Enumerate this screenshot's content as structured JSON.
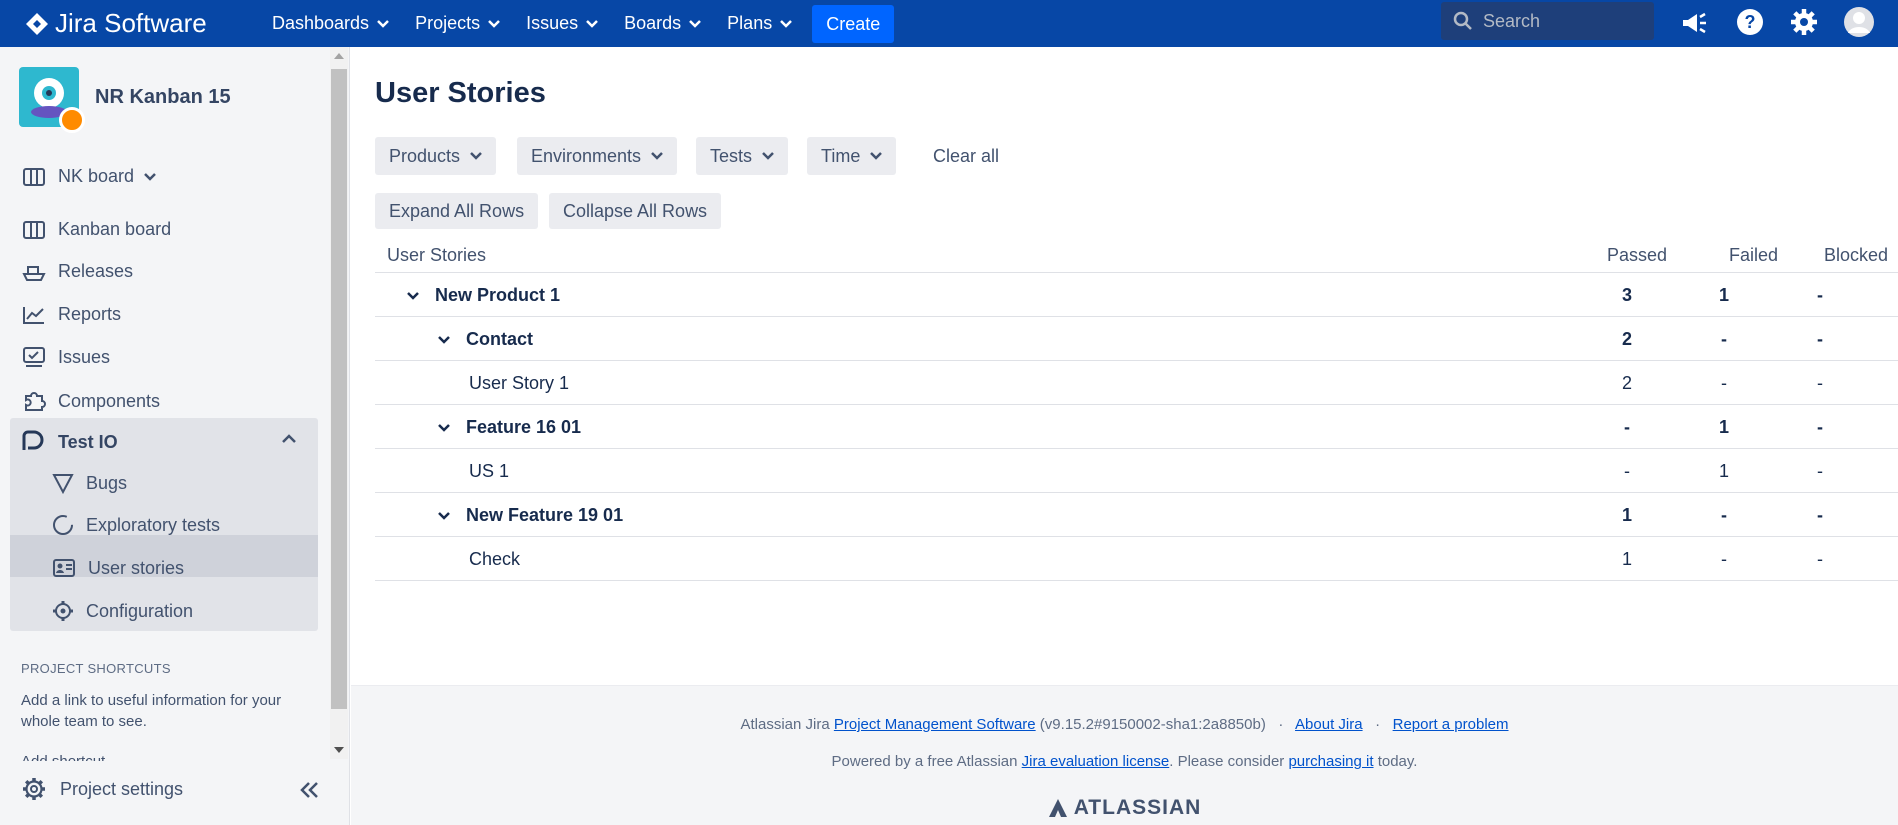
{
  "app": {
    "name": "Jira Software"
  },
  "topnav": {
    "items": [
      {
        "label": "Dashboards"
      },
      {
        "label": "Projects"
      },
      {
        "label": "Issues"
      },
      {
        "label": "Boards"
      },
      {
        "label": "Plans"
      }
    ],
    "create_label": "Create",
    "search_placeholder": "Search",
    "icons": [
      "megaphone-icon",
      "help-icon",
      "settings-icon",
      "user-avatar-icon"
    ]
  },
  "sidebar": {
    "project_name": "NR Kanban 15",
    "board_selector": "NK board",
    "items": [
      {
        "label": "Kanban board",
        "icon": "board-icon"
      },
      {
        "label": "Releases",
        "icon": "ship-icon"
      },
      {
        "label": "Reports",
        "icon": "chart-icon"
      },
      {
        "label": "Issues",
        "icon": "issues-icon"
      },
      {
        "label": "Components",
        "icon": "puzzle-icon"
      }
    ],
    "group": {
      "label": "Test IO",
      "items": [
        {
          "label": "Bugs",
          "icon": "triangle-icon"
        },
        {
          "label": "Exploratory tests",
          "icon": "circle-progress-icon"
        },
        {
          "label": "User stories",
          "icon": "id-card-icon",
          "active": true
        },
        {
          "label": "Configuration",
          "icon": "gear-icon"
        }
      ]
    },
    "shortcuts_title": "PROJECT SHORTCUTS",
    "shortcuts_text": "Add a link to useful information for your whole team to see.",
    "add_shortcut": "Add shortcut",
    "project_settings": "Project settings"
  },
  "main": {
    "title": "User Stories",
    "filters": [
      "Products",
      "Environments",
      "Tests",
      "Time"
    ],
    "clear_all": "Clear all",
    "expand_all": "Expand All Rows",
    "collapse_all": "Collapse All Rows",
    "table": {
      "headers": {
        "name": "User Stories",
        "passed": "Passed",
        "failed": "Failed",
        "blocked": "Blocked"
      },
      "rows": [
        {
          "name": "New Product 1",
          "level": 0,
          "expandable": true,
          "passed": "3",
          "failed": "1",
          "blocked": "-"
        },
        {
          "name": "Contact",
          "level": 1,
          "expandable": true,
          "passed": "2",
          "failed": "-",
          "blocked": "-"
        },
        {
          "name": "User Story 1",
          "level": 2,
          "expandable": false,
          "passed": "2",
          "failed": "-",
          "blocked": "-"
        },
        {
          "name": "Feature 16 01",
          "level": 1,
          "expandable": true,
          "passed": "-",
          "failed": "1",
          "blocked": "-"
        },
        {
          "name": "US 1",
          "level": 2,
          "expandable": false,
          "passed": "-",
          "failed": "1",
          "blocked": "-"
        },
        {
          "name": "New Feature 19 01",
          "level": 1,
          "expandable": true,
          "passed": "1",
          "failed": "-",
          "blocked": "-"
        },
        {
          "name": "Check",
          "level": 2,
          "expandable": false,
          "passed": "1",
          "failed": "-",
          "blocked": "-"
        }
      ]
    }
  },
  "footer": {
    "line1_prefix": "Atlassian Jira ",
    "line1_link": "Project Management Software",
    "line1_version": " (v9.15.2#9150002-sha1:2a8850b)",
    "sep": "·",
    "about": "About Jira",
    "report": "Report a problem",
    "line2_prefix": "Powered by a free Atlassian ",
    "line2_link": "Jira evaluation license",
    "line2_mid": ". Please consider ",
    "line2_link2": "purchasing it",
    "line2_suffix": " today.",
    "brand": "ATLASSIAN"
  }
}
